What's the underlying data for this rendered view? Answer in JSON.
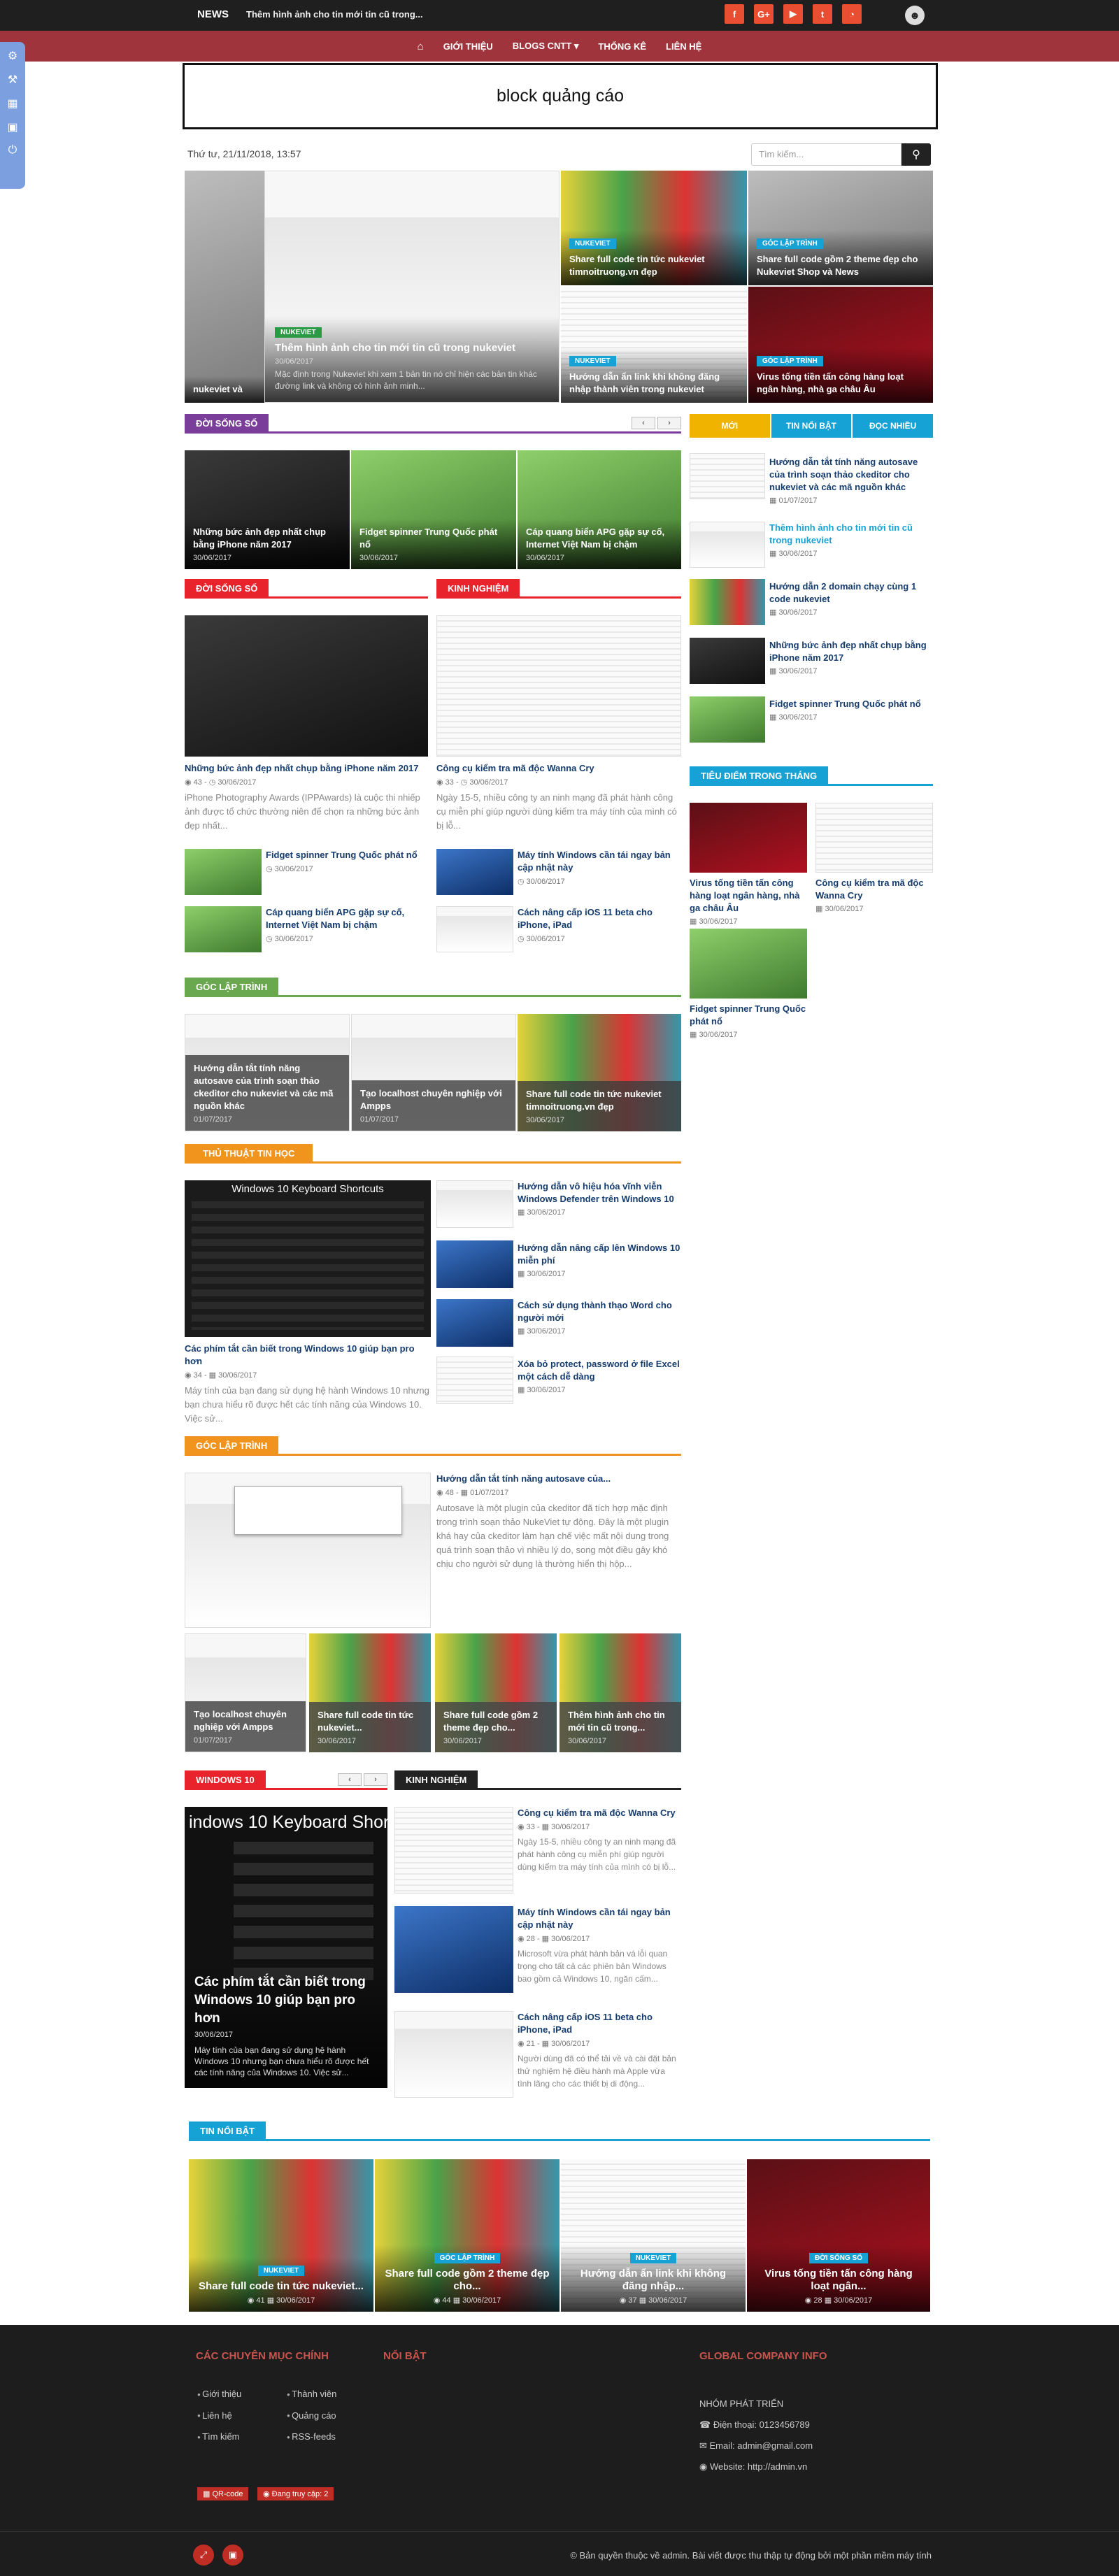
{
  "topbar": {
    "brand": "NEWS",
    "ticker": "Thêm hình ảnh cho tin mới tin cũ trong...",
    "social": [
      "f",
      "G+",
      "▶",
      "t",
      "◔"
    ],
    "user_icon": "user-icon"
  },
  "nav": {
    "home_icon": "⌂",
    "items": [
      "GIỚI THIỆU",
      "BLOGS CNTT ▾",
      "THỐNG KÊ",
      "LIÊN HỆ"
    ]
  },
  "ad": {
    "text": "block quảng cáo"
  },
  "date": "Thứ tư, 21/11/2018, 13:57",
  "search": {
    "placeholder": "Tìm kiếm...",
    "icon": "search-icon"
  },
  "hero": {
    "main": {
      "category": "NUKEVIET",
      "title": "Thêm hình ảnh cho tin mới tin cũ trong nukeviet",
      "date": "30/06/2017",
      "excerpt": "Mặc định trong Nukeviet khi xem 1 bản tin nó chỉ hiện các bản tin khác đường link và không có hình ảnh minh..."
    },
    "left_partial": "nukeviet và",
    "cards": [
      {
        "category": "NUKEVIET",
        "title": "Share full code tin tức nukeviet timnoitruong.vn đẹp"
      },
      {
        "category": "GÓC LẬP TRÌNH",
        "title": "Share full code gồm 2 theme đẹp cho Nukeviet Shop và News"
      },
      {
        "category": "NUKEVIET",
        "title": "Hướng dẫn ẩn link khi không đăng nhập thành viên trong nukeviet"
      },
      {
        "category": "GÓC LẬP TRÌNH",
        "title": "Virus tống tiền tấn công hàng loạt ngân hàng, nhà ga châu Âu"
      }
    ]
  },
  "doi_song_so_1": {
    "heading": "ĐỜI SỐNG SỐ",
    "items": [
      {
        "title": "Những bức ảnh đẹp nhất chụp bằng iPhone năm 2017",
        "date": "30/06/2017"
      },
      {
        "title": "Fidget spinner Trung Quốc phát nổ",
        "date": "30/06/2017"
      },
      {
        "title": "Cáp quang biển APG gặp sự cố, Internet Việt Nam bị chậm",
        "date": "30/06/2017"
      }
    ]
  },
  "doi_song_so_2": {
    "heading": "ĐỜI SỐNG SỐ",
    "main": {
      "title": "Những bức ảnh đẹp nhất chụp bằng iPhone năm 2017",
      "views": "43",
      "date": "30/06/2017",
      "excerpt": "iPhone Photography Awards (IPPAwards) là cuộc thi nhiếp ảnh được tổ chức thường niên để chọn ra những bức ảnh đẹp nhất..."
    },
    "list": [
      {
        "title": "Fidget spinner Trung Quốc phát nổ",
        "date": "30/06/2017"
      },
      {
        "title": "Cáp quang biển APG gặp sự cố, Internet Việt Nam bị chậm",
        "date": "30/06/2017"
      }
    ]
  },
  "kinh_nghiem_1": {
    "heading": "KINH NGHIỆM",
    "main": {
      "title": "Công cụ kiểm tra mã độc Wanna Cry",
      "views": "33",
      "date": "30/06/2017",
      "excerpt": "Ngày 15-5, nhiều công ty an ninh mạng đã phát hành công cụ miễn phí giúp người dùng kiểm tra máy tính của mình có bị lỗ..."
    },
    "list": [
      {
        "title": "Máy tính Windows cần tái ngay bản cập nhật này",
        "date": "30/06/2017"
      },
      {
        "title": "Cách nâng cấp iOS 11 beta cho iPhone, iPad",
        "date": "30/06/2017"
      }
    ]
  },
  "sidebar_tabs": [
    "MỚI",
    "TIN NỔI BẬT",
    "ĐỌC NHIỀU"
  ],
  "sidebar_list": [
    {
      "title": "Hướng dẫn tắt tính năng autosave của trình soạn thảo ckeditor cho nukeviet và các mã nguồn khác",
      "date": "01/07/2017"
    },
    {
      "title": "Thêm hình ảnh cho tin mới tin cũ trong nukeviet",
      "date": "30/06/2017"
    },
    {
      "title": "Hướng dẫn 2 domain chạy cùng 1 code nukeviet",
      "date": "30/06/2017"
    },
    {
      "title": "Những bức ảnh đẹp nhất chụp bằng iPhone năm 2017",
      "date": "30/06/2017"
    },
    {
      "title": "Fidget spinner Trung Quốc phát nổ",
      "date": "30/06/2017"
    }
  ],
  "tieu_diem": {
    "heading": "TIÊU ĐIỂM TRONG THÁNG",
    "items": [
      {
        "title": "Virus tống tiền tấn công hàng loạt ngân hàng, nhà ga châu Âu",
        "date": "30/06/2017"
      },
      {
        "title": "Công cụ kiểm tra mã độc Wanna Cry",
        "date": "30/06/2017"
      },
      {
        "title": "Fidget spinner Trung Quốc phát nổ",
        "date": "30/06/2017"
      }
    ]
  },
  "goc_lap_trinh_1": {
    "heading": "GÓC LẬP TRÌNH",
    "items": [
      {
        "title": "Hướng dẫn tắt tính năng autosave của trình soạn thảo ckeditor cho nukeviet và các mã nguồn khác",
        "date": "01/07/2017"
      },
      {
        "title": "Tạo localhost chuyên nghiệp với Ampps",
        "date": "01/07/2017"
      },
      {
        "title": "Share full code tin tức nukeviet timnoitruong.vn đẹp",
        "date": "30/06/2017"
      }
    ]
  },
  "thu_thuat": {
    "heading": "THỦ THUẬT TIN HỌC",
    "main": {
      "title": "Các phím tắt cần biết trong Windows 10 giúp bạn pro hơn",
      "views": "34",
      "date": "30/06/2017",
      "excerpt": "Máy tính của bạn đang sử dụng hệ hành Windows 10 nhưng bạn chưa hiểu rõ được hết các tính năng của Windows 10. Việc sử..."
    },
    "image_caption": "Windows 10 Keyboard Shortcuts",
    "list": [
      {
        "title": "Hướng dẫn vô hiệu hóa vĩnh viễn Windows Defender trên Windows 10",
        "date": "30/06/2017"
      },
      {
        "title": "Hướng dẫn nâng cấp lên Windows 10 miễn phí",
        "date": "30/06/2017"
      },
      {
        "title": "Cách sử dụng thành thạo Word cho người mới",
        "date": "30/06/2017"
      },
      {
        "title": "Xóa bỏ protect, password ở file Excel một cách dễ dàng",
        "date": "30/06/2017"
      }
    ]
  },
  "goc_lap_trinh_2": {
    "heading": "GÓC LẬP TRÌNH",
    "main": {
      "title": "Hướng dẫn tắt tính năng autosave của...",
      "views": "48",
      "date": "01/07/2017",
      "excerpt": "Autosave là một plugin của ckeditor đã tích hợp mặc định trong trình soạn thảo NukeViet tự động. Đây là một plugin khá hay của ckeditor làm hạn chế việc mất nội dung trong quá trình soạn thảo vì nhiều lý do, song một điều gây khó chịu cho người sử dụng là thường hiển thị hộp..."
    },
    "grid": [
      {
        "title": "Tạo localhost chuyên nghiệp với Ampps",
        "date": "01/07/2017"
      },
      {
        "title": "Share full code tin tức nukeviet...",
        "date": "30/06/2017"
      },
      {
        "title": "Share full code gồm 2 theme đẹp cho...",
        "date": "30/06/2017"
      },
      {
        "title": "Thêm hình ảnh cho tin mới tin cũ trong...",
        "date": "30/06/2017"
      }
    ]
  },
  "windows10": {
    "heading": "WINDOWS 10",
    "image_caption": "indows 10 Keyboard Shortc",
    "title": "Các phím tắt cần biết trong Windows 10 giúp bạn pro hơn",
    "date": "30/06/2017",
    "excerpt": "Máy tính của bạn đang sử dụng hệ hành Windows 10 nhưng bạn chưa hiểu rõ được hết các tính năng của Windows 10. Việc sử..."
  },
  "kinh_nghiem_2": {
    "heading": "KINH NGHIỆM",
    "items": [
      {
        "title": "Công cụ kiểm tra mã độc Wanna Cry",
        "views": "33",
        "date": "30/06/2017",
        "excerpt": "Ngày 15-5, nhiều công ty an ninh mạng đã phát hành công cụ miễn phí giúp người dùng kiểm tra máy tính của mình có bị lỗ..."
      },
      {
        "title": "Máy tính Windows cần tái ngay bản cập nhật này",
        "views": "28",
        "date": "30/06/2017",
        "excerpt": "Microsoft vừa phát hành bản vá lỗi quan trọng cho tất cả các phiên bản Windows bao gồm cả Windows 10, ngăn cấm..."
      },
      {
        "title": "Cách nâng cấp iOS 11 beta cho iPhone, iPad",
        "views": "21",
        "date": "30/06/2017",
        "excerpt": "Người dùng đã có thể tải về và cài đặt bản thử nghiệm hệ điều hành mà Apple vừa tình lãng cho các thiết bị di động..."
      }
    ]
  },
  "tin_noi_bat": {
    "heading": "TIN NỔI BẬT",
    "items": [
      {
        "category": "NUKEVIET",
        "title": "Share full code tin tức nukeviet...",
        "views": "41",
        "date": "30/06/2017"
      },
      {
        "category": "GÓC LẬP TRÌNH",
        "title": "Share full code gồm 2 theme đẹp cho...",
        "views": "44",
        "date": "30/06/2017"
      },
      {
        "category": "NUKEVIET",
        "title": "Hướng dẫn ẩn link khi không đăng nhập...",
        "views": "37",
        "date": "30/06/2017"
      },
      {
        "category": "ĐỜI SỐNG SỐ",
        "title": "Virus tống tiền tấn công hàng loạt ngân...",
        "views": "28",
        "date": "30/06/2017"
      }
    ]
  },
  "footer": {
    "col1_heading": "CÁC CHUYÊN MỤC CHÍNH",
    "col1_a": [
      "Giới thiệu",
      "Liên hệ",
      "Tìm kiếm"
    ],
    "col1_b": [
      "Thành viên",
      "Quảng cáo",
      "RSS-feeds"
    ],
    "col2_heading": "NỔI BẬT",
    "col3_heading": "GLOBAL COMPANY INFO",
    "company": "NHÓM PHÁT TRIỂN",
    "phone": "Điện thoại: 0123456789",
    "email": "Email: admin@gmail.com",
    "website": "Website: http://admin.vn",
    "btn_qr": "QR-code",
    "btn_online": "Đang truy cập: 2",
    "copyright": "© Bản quyền thuộc về admin. Bài viết được thu thập tự động bởi một phần mềm máy tính"
  }
}
